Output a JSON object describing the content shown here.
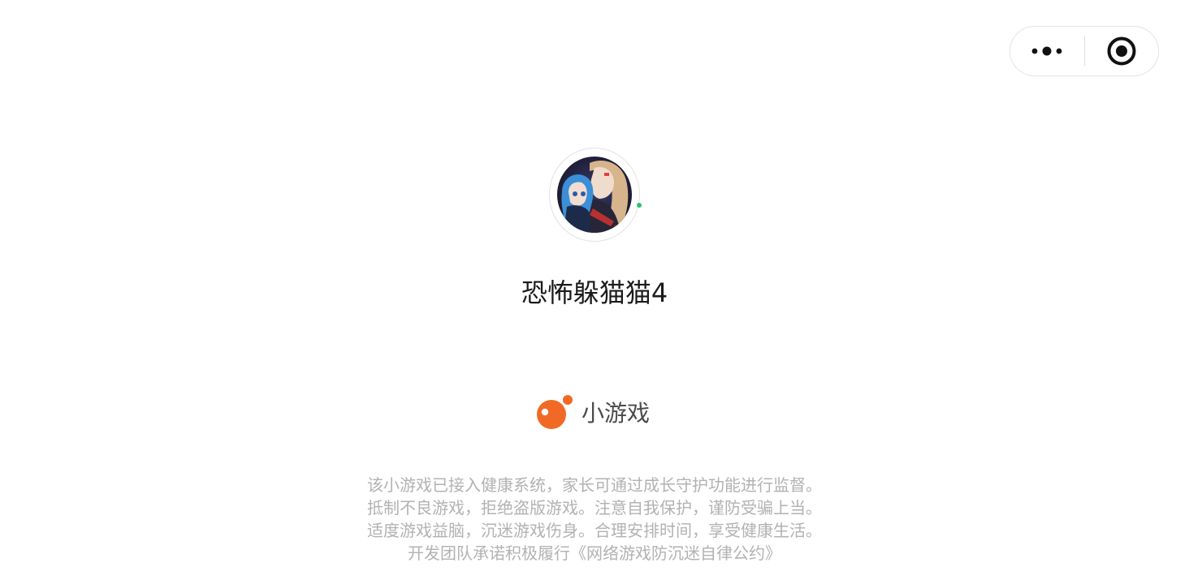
{
  "capsule": {
    "more_icon": "more-dots-icon",
    "close_icon": "target-close-icon"
  },
  "game": {
    "title": "恐怖躲猫猫4",
    "online_color": "#2bc36b"
  },
  "brand": {
    "label": "小游戏",
    "accent": "#f06a25"
  },
  "notice": {
    "lines": [
      "该小游戏已接入健康系统，家长可通过成长守护功能进行监督。",
      "抵制不良游戏，拒绝盗版游戏。注意自我保护，谨防受骗上当。",
      "适度游戏益脑，沉迷游戏伤身。合理安排时间，享受健康生活。",
      "开发团队承诺积极履行《网络游戏防沉迷自律公约》"
    ]
  }
}
